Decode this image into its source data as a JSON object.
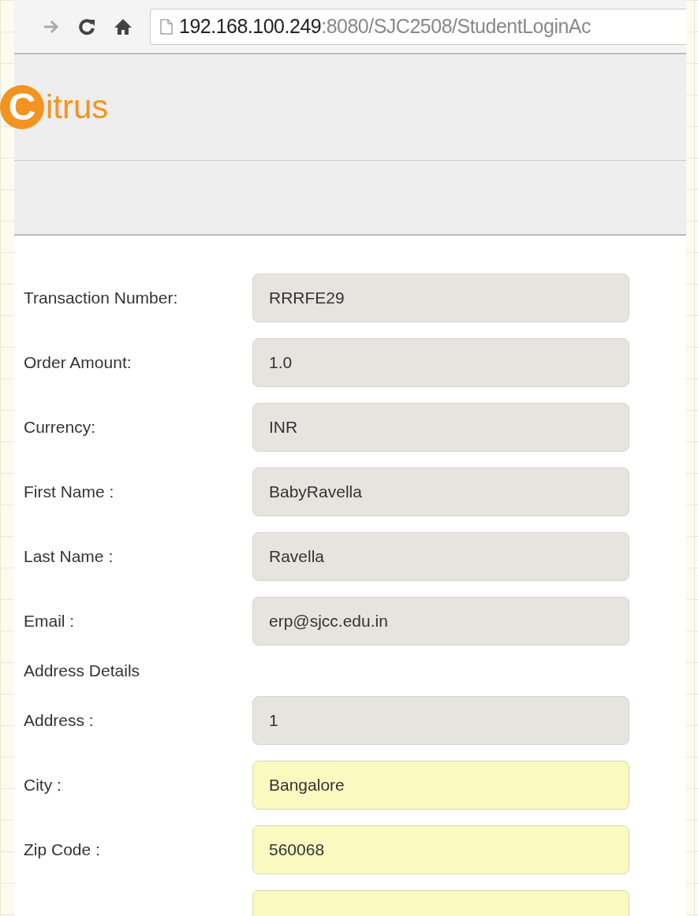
{
  "browser": {
    "url_host": "192.168.100.249",
    "url_rest": ":8080/SJC2508/StudentLoginAc"
  },
  "logo": {
    "mark": "C",
    "text": "itrus"
  },
  "fields": [
    {
      "label": "Transaction Number:",
      "value": "RRRFE29",
      "editable": false
    },
    {
      "label": "Order Amount:",
      "value": "1.0",
      "editable": false
    },
    {
      "label": "Currency:",
      "value": "INR",
      "editable": false
    },
    {
      "label": "First Name :",
      "value": "BabyRavella",
      "editable": false
    },
    {
      "label": "Last Name :",
      "value": "Ravella",
      "editable": false
    },
    {
      "label": "Email :",
      "value": "erp@sjcc.edu.in",
      "editable": false
    }
  ],
  "address_heading": "Address Details",
  "address_fields": [
    {
      "label": "Address :",
      "value": "1",
      "editable": false
    },
    {
      "label": "City :",
      "value": "Bangalore",
      "editable": true
    },
    {
      "label": "Zip Code :",
      "value": "560068",
      "editable": true
    },
    {
      "editable": true
    }
  ]
}
